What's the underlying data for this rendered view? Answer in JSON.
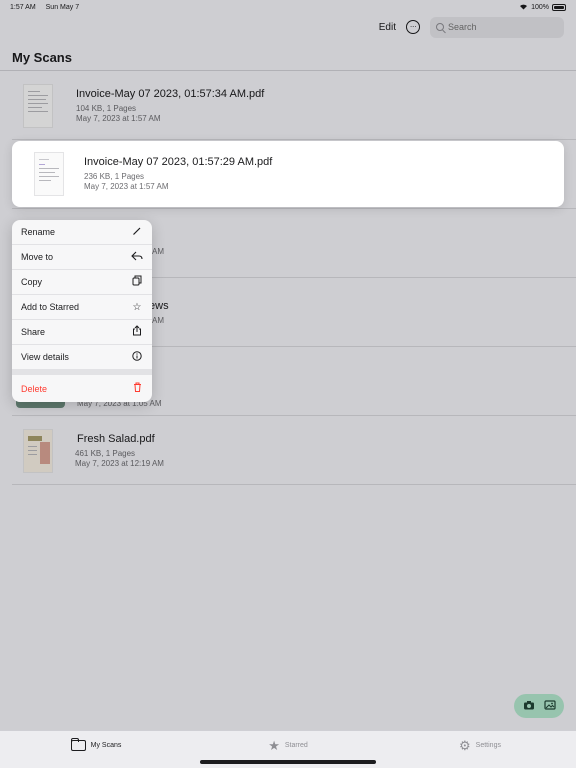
{
  "status": {
    "time": "1:57 AM",
    "date": "Sun May 7",
    "battery": "100%"
  },
  "nav": {
    "edit_label": "Edit",
    "search_placeholder": "Search"
  },
  "page": {
    "title": "My Scans"
  },
  "files": [
    {
      "name": "Invoice-May 07 2023, 01:57:34 AM.pdf",
      "size_pages": "104 KB, 1 Pages",
      "date": "May 7, 2023 at 1:57 AM"
    },
    {
      "name": "Invoice-May 07 2023, 01:57:29 AM.pdf",
      "size_pages": "236 KB, 1 Pages",
      "date": "May 7, 2023 at 1:57 AM"
    },
    {
      "name": "ts",
      "size_pages": "",
      "date": "AM"
    },
    {
      "name": "eviews",
      "size_pages": "",
      "date": "AM"
    },
    {
      "name": "",
      "size_pages": "",
      "date": "May 7, 2023 at 1:05 AM"
    },
    {
      "name": "Fresh Salad.pdf",
      "size_pages": "461 KB, 1 Pages",
      "date": "May 7, 2023 at 12:19 AM"
    }
  ],
  "context_menu": {
    "items": [
      {
        "label": "Rename",
        "icon": "pencil-icon"
      },
      {
        "label": "Move to",
        "icon": "arrow-back-icon"
      },
      {
        "label": "Copy",
        "icon": "copy-icon"
      },
      {
        "label": "Add to Starred",
        "icon": "star-icon"
      },
      {
        "label": "Share",
        "icon": "share-icon"
      },
      {
        "label": "View details",
        "icon": "info-icon"
      }
    ],
    "delete_label": "Delete"
  },
  "tabs": [
    {
      "label": "My Scans",
      "icon": "folder-icon",
      "active": true
    },
    {
      "label": "Starred",
      "icon": "star-icon",
      "active": false
    },
    {
      "label": "Settings",
      "icon": "gear-icon",
      "active": false
    }
  ],
  "colors": {
    "accent_green": "#97c4ae",
    "destructive": "#ff3b30"
  }
}
